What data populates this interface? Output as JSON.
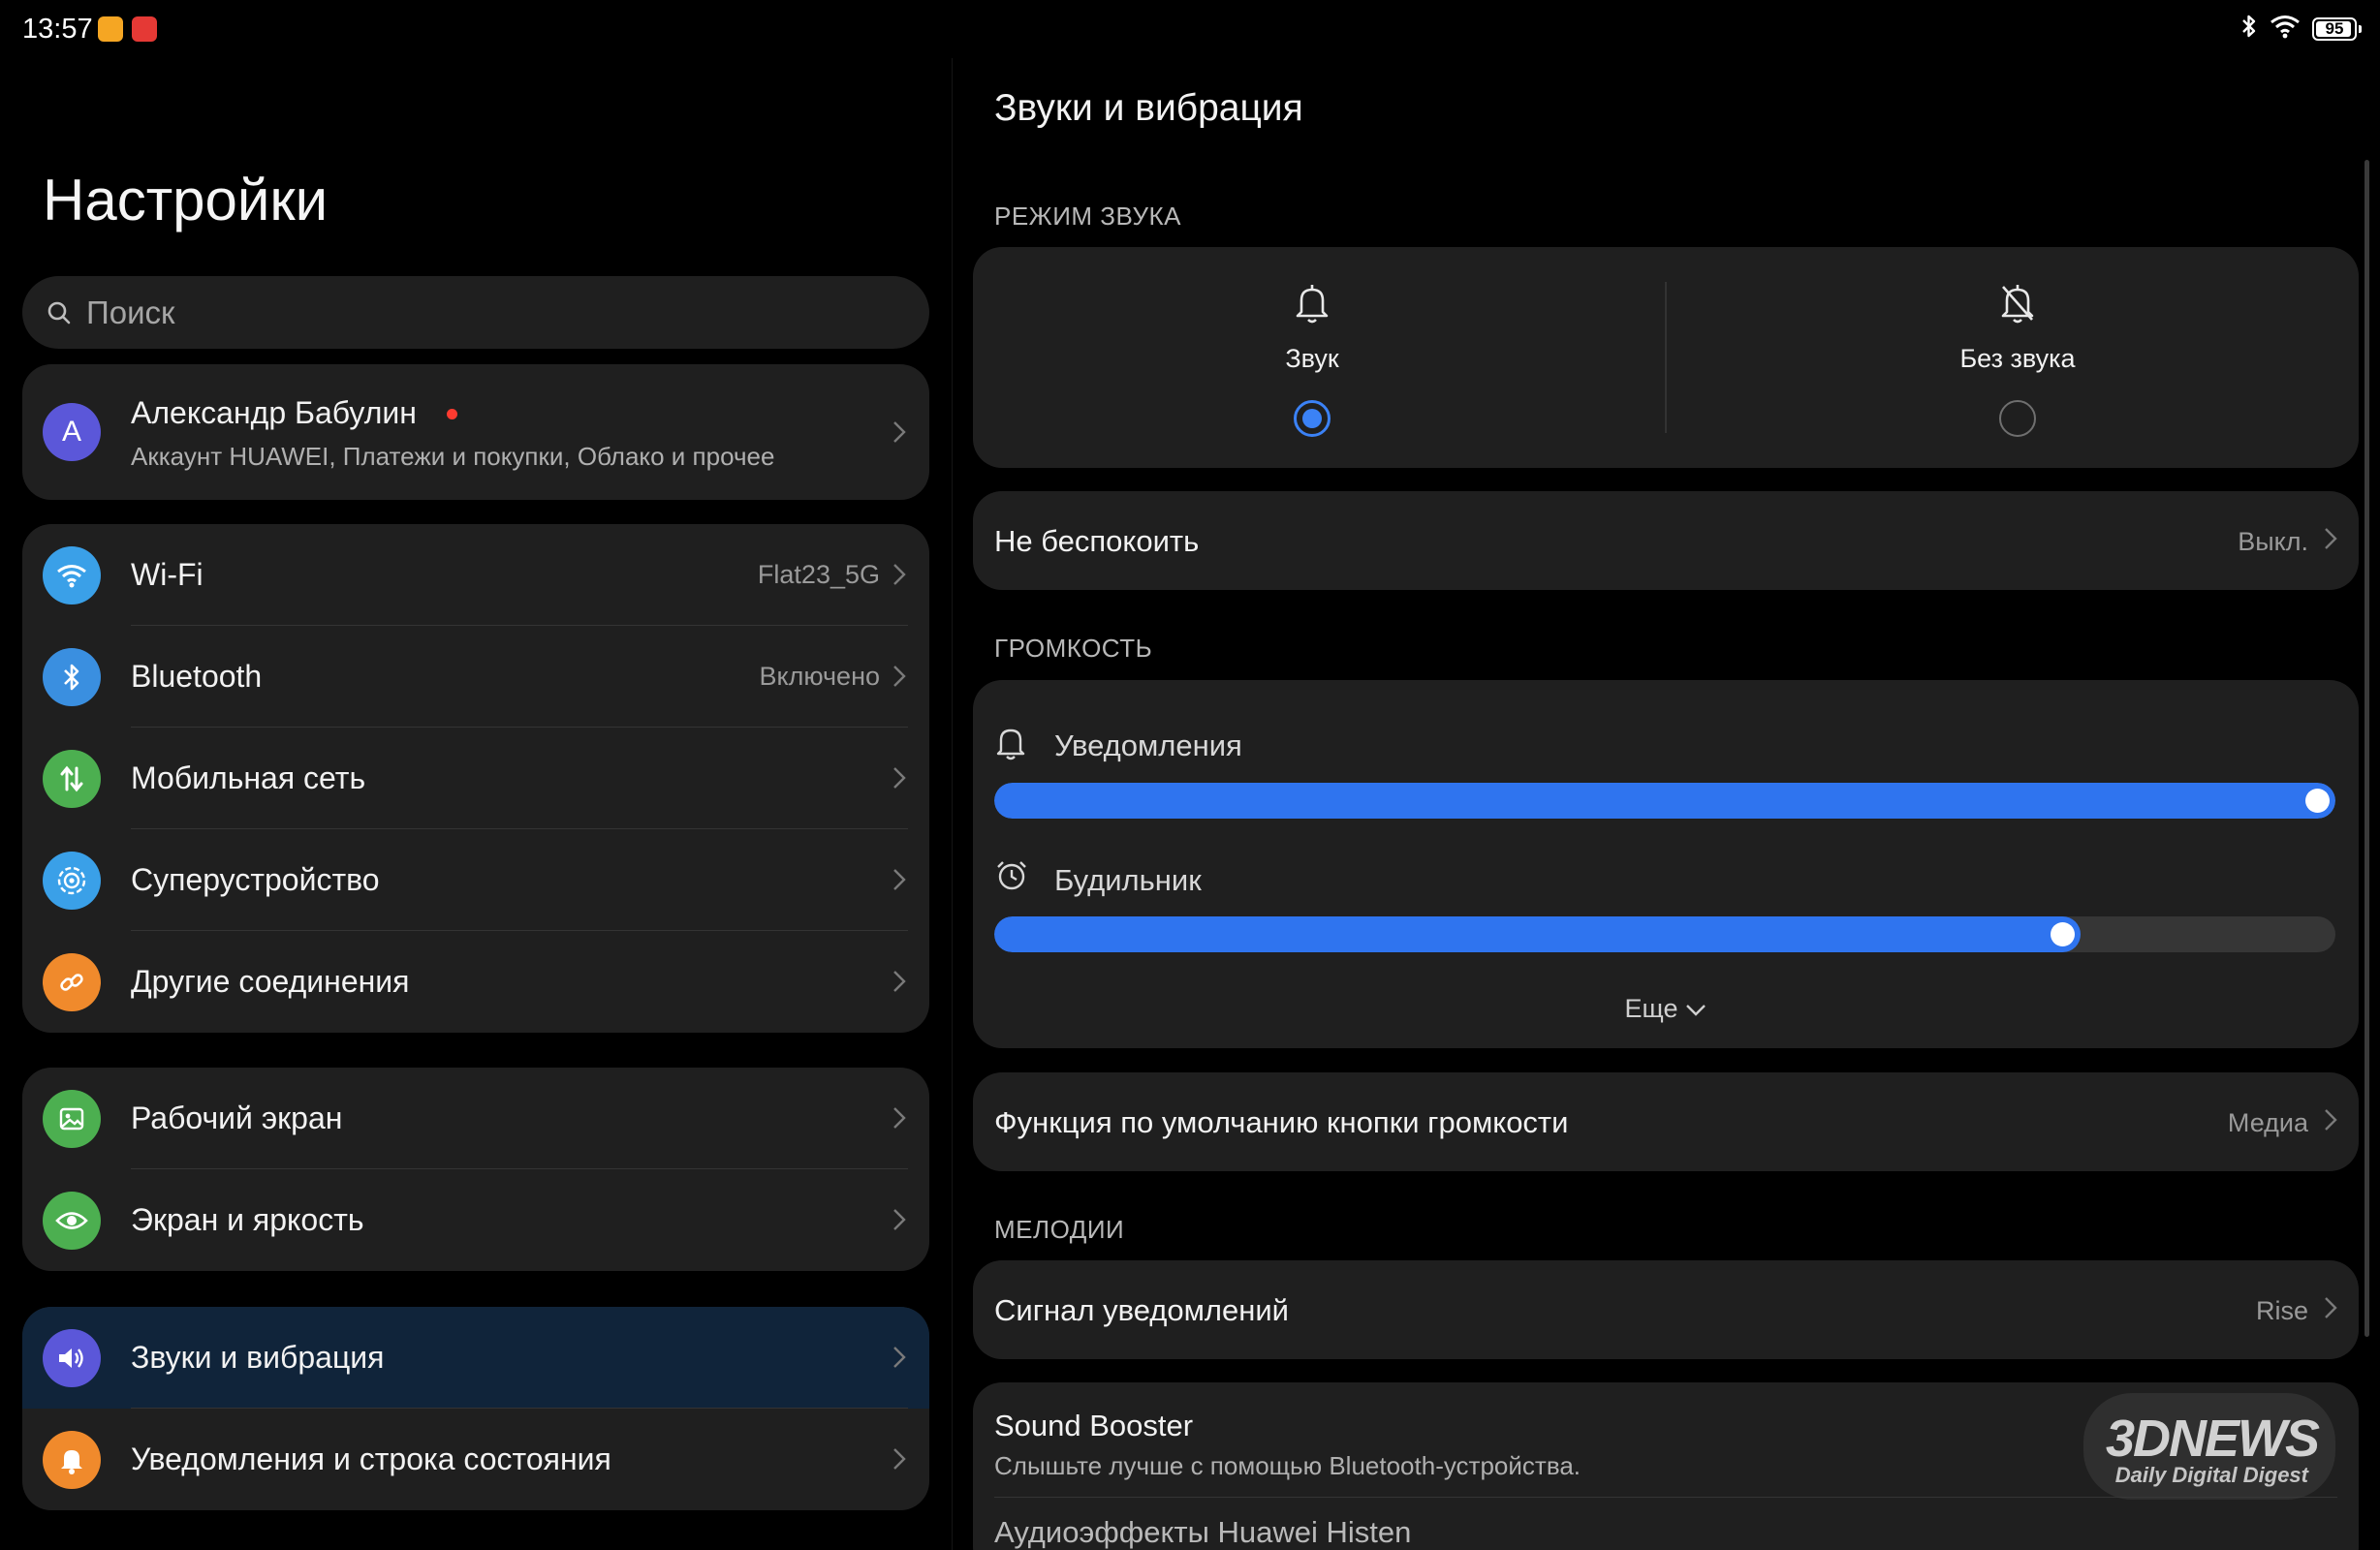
{
  "status_bar": {
    "time": "13:57",
    "app_icons": [
      {
        "icon": "app-notification-icon",
        "color": "#f5a623"
      },
      {
        "icon": "app-notification-icon",
        "color": "#e53935"
      }
    ],
    "battery_percent": 95,
    "battery_label": "95",
    "icons": [
      "bluetooth-icon",
      "wifi-icon",
      "battery-icon"
    ]
  },
  "left": {
    "title": "Настройки",
    "search_placeholder": "Поиск",
    "account": {
      "avatar_letter": "А",
      "name": "Александр Бабулин",
      "subtitle": "Аккаунт HUAWEI, Платежи и покупки, Облако и прочее"
    },
    "groups": [
      [
        {
          "label": "Wi-Fi",
          "value": "Flat23_5G",
          "icon": "wifi-icon",
          "color": "#3aa0e8"
        },
        {
          "label": "Bluetooth",
          "value": "Включено",
          "icon": "bluetooth-icon",
          "color": "#3a8fe0"
        },
        {
          "label": "Мобильная сеть",
          "value": "",
          "icon": "mobile-data-icon",
          "color": "#4caf50"
        },
        {
          "label": "Суперустройство",
          "value": "",
          "icon": "super-device-icon",
          "color": "#3aa0e8"
        },
        {
          "label": "Другие соединения",
          "value": "",
          "icon": "link-icon",
          "color": "#f08a2c"
        }
      ],
      [
        {
          "label": "Рабочий экран",
          "value": "",
          "icon": "home-screen-icon",
          "color": "#4caf50"
        },
        {
          "label": "Экран и яркость",
          "value": "",
          "icon": "eye-icon",
          "color": "#4caf50"
        }
      ],
      [
        {
          "label": "Звуки и вибрация",
          "value": "",
          "icon": "speaker-icon",
          "color": "#5b57d9",
          "active": true
        },
        {
          "label": "Уведомления и строка состояния",
          "value": "",
          "icon": "bell-icon",
          "color": "#f08a2c"
        }
      ]
    ]
  },
  "right": {
    "title": "Звуки и вибрация",
    "sections": {
      "mode": "РЕЖИМ ЗВУКА",
      "volume": "ГРОМКОСТЬ",
      "ringtones": "МЕЛОДИИ"
    },
    "modes": [
      {
        "label": "Звук",
        "selected": true,
        "icon": "bell-icon"
      },
      {
        "label": "Без звука",
        "selected": false,
        "icon": "bell-off-icon"
      }
    ],
    "dnd": {
      "label": "Не беспокоить",
      "value": "Выкл."
    },
    "volumes": [
      {
        "label": "Уведомления",
        "level": 1.0,
        "icon": "bell-icon"
      },
      {
        "label": "Будильник",
        "level": 0.81,
        "icon": "alarm-icon"
      }
    ],
    "more_label": "Еще",
    "volume_button": {
      "label": "Функция по умолчанию кнопки громкости",
      "value": "Медиа"
    },
    "notification_tone": {
      "label": "Сигнал уведомлений",
      "value": "Rise"
    },
    "sound_booster": {
      "title": "Sound Booster",
      "subtitle": "Слышьте лучше с помощью Bluetooth-устройства.",
      "next_item": "Аудиоэффекты Huawei Histen"
    },
    "watermark": {
      "main": "3DNEWS",
      "sub": "Daily Digital Digest"
    }
  },
  "colors": {
    "background": "#000000",
    "card": "#1f1f1f",
    "accent": "#2f74ef",
    "active_row": "#10243a"
  }
}
